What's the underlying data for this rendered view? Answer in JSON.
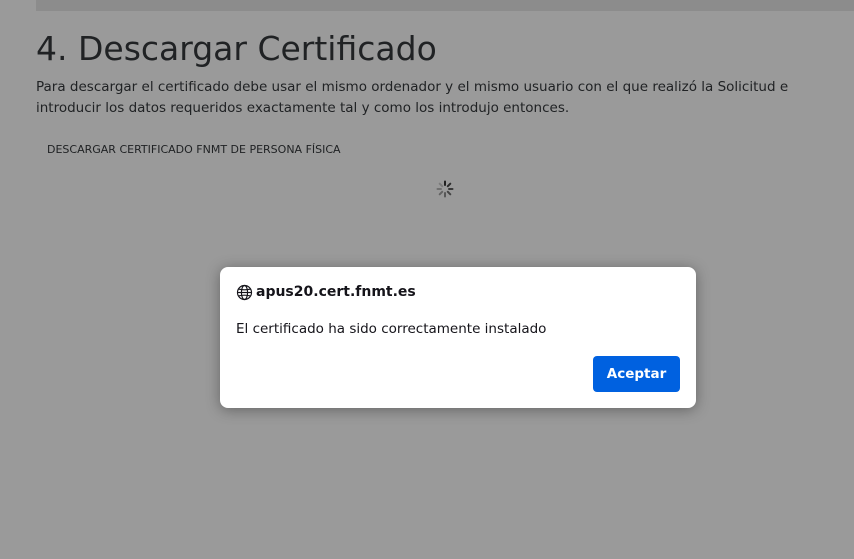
{
  "page": {
    "title": "4. Descargar Certificado",
    "intro": "Para descargar el certificado debe usar el mismo ordenador y el mismo usuario con el que realizó la Solicitud e introducir los datos requeridos exactamente tal y como los introdujo entonces.",
    "section_link": "DESCARGAR CERTIFICADO FNMT DE PERSONA FÍSICA",
    "spinner_icon": "loading-spinner-icon"
  },
  "dialog": {
    "origin": "apus20.cert.fnmt.es",
    "origin_icon": "globe-icon",
    "message": "El certificado ha sido correctamente instalado",
    "accept_label": "Aceptar",
    "accent_color": "#0061e0"
  },
  "overlay": {
    "color": "rgba(30,30,30,0.45)"
  }
}
